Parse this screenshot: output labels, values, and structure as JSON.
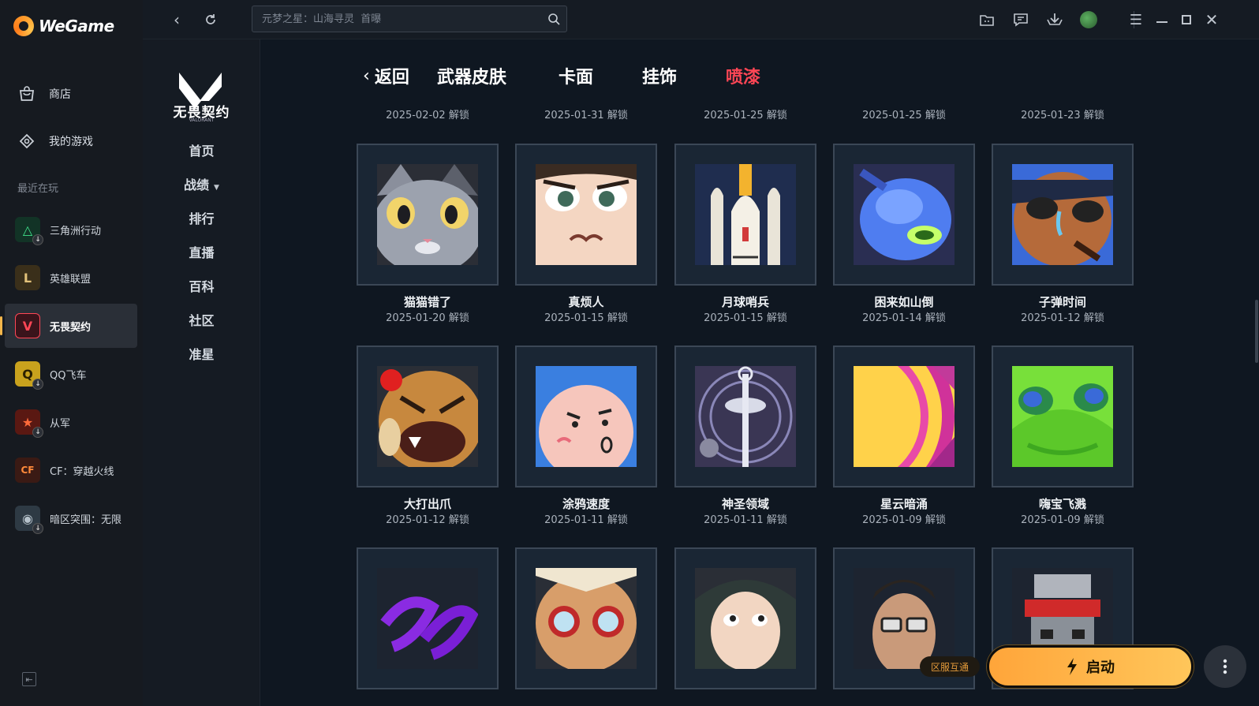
{
  "app": {
    "name": "WeGame"
  },
  "sidebar": {
    "nav": [
      {
        "label": "商店",
        "icon": "shop-bag-icon"
      },
      {
        "label": "我的游戏",
        "icon": "game-controller-icon"
      }
    ],
    "recent_label": "最近在玩",
    "games": [
      {
        "label": "三角洲行动",
        "icon": "delta-force-icon",
        "color": "#1b3b2d",
        "glyph": "△"
      },
      {
        "label": "英雄联盟",
        "icon": "league-of-legends-icon",
        "color": "#3a2f1a",
        "glyph": "L"
      },
      {
        "label": "无畏契约",
        "icon": "valorant-icon",
        "color": "#2a1216",
        "glyph": "V"
      },
      {
        "label": "QQ飞车",
        "icon": "qq-speed-icon",
        "color": "#6a5a1a",
        "glyph": "Q"
      },
      {
        "label": "从军",
        "icon": "enlisted-star-icon",
        "color": "#4a1510",
        "glyph": "★"
      },
      {
        "label": "CF：穿越火线",
        "icon": "crossfire-icon",
        "color": "#3a1a14",
        "glyph": "CF"
      },
      {
        "label": "暗区突围：无限",
        "icon": "arena-breakout-icon",
        "color": "#2e3a44",
        "glyph": "◉"
      }
    ]
  },
  "topbar": {
    "search_placeholder": "元梦之星：山海寻灵  首曝"
  },
  "subnav": {
    "logo_text": "无畏契约",
    "logo_sub": "VALORANT",
    "items": [
      "首页",
      "战绩",
      "排行",
      "直播",
      "百科",
      "社区",
      "准星"
    ]
  },
  "tabs": {
    "back": "返回",
    "items": [
      "武器皮肤",
      "卡面",
      "挂饰",
      "喷漆"
    ],
    "active": "喷漆"
  },
  "top_dates": [
    "2025-02-02 解锁",
    "2025-01-31 解锁",
    "2025-01-25 解锁",
    "2025-01-25 解锁",
    "2025-01-23 解锁"
  ],
  "sprays": [
    {
      "name": "猫猫错了",
      "date": "2025-01-20 解锁"
    },
    {
      "name": "真烦人",
      "date": "2025-01-15 解锁"
    },
    {
      "name": "月球哨兵",
      "date": "2025-01-15 解锁"
    },
    {
      "name": "困来如山倒",
      "date": "2025-01-14 解锁"
    },
    {
      "name": "子弹时间",
      "date": "2025-01-12 解锁"
    },
    {
      "name": "大打出爪",
      "date": "2025-01-12 解锁"
    },
    {
      "name": "涂鸦速度",
      "date": "2025-01-11 解锁"
    },
    {
      "name": "神圣领域",
      "date": "2025-01-11 解锁"
    },
    {
      "name": "星云暗涌",
      "date": "2025-01-09 解锁"
    },
    {
      "name": "嗨宝飞溅",
      "date": "2025-01-09 解锁"
    }
  ],
  "bottom": {
    "region_badge": "区服互通",
    "launch_label": "启动"
  },
  "colors": {
    "accent": "#ff4655",
    "launch": "#ffb247"
  }
}
